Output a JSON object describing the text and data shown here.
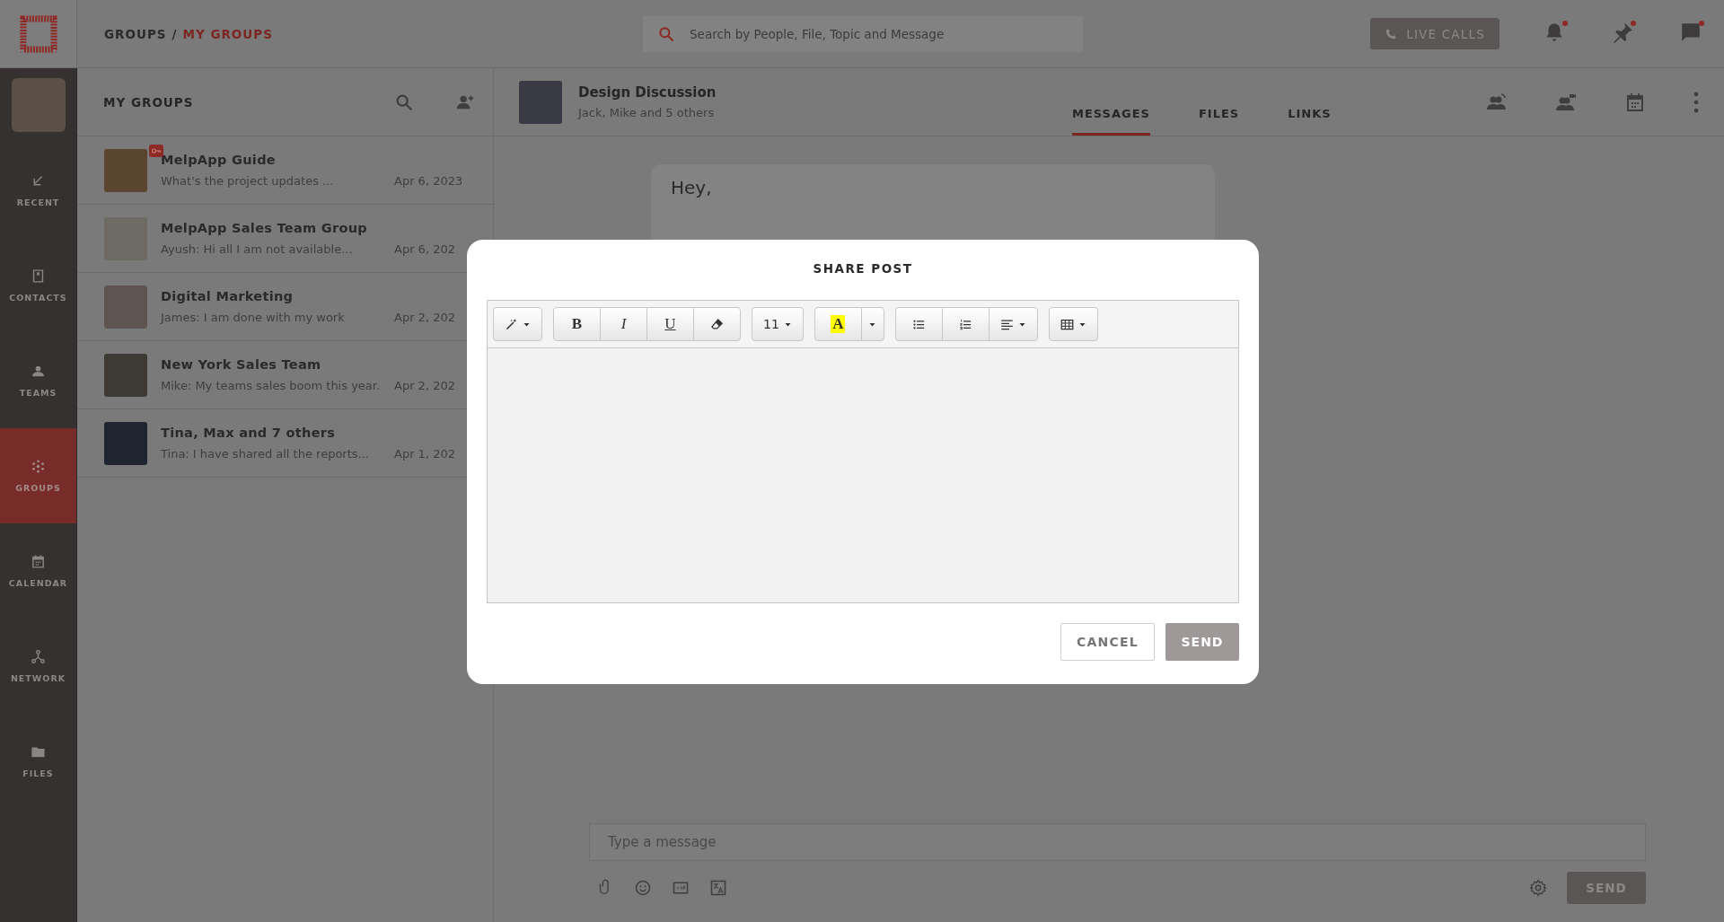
{
  "top_bar": {
    "breadcrumb": [
      {
        "label": "GROUPS",
        "current": false
      },
      {
        "label": "MY GROUPS",
        "current": true
      }
    ],
    "separator": "/",
    "search": {
      "placeholder": "Search by People, File, Topic and Message"
    },
    "live_calls": "LIVE CALLS",
    "icons": [
      {
        "kind": "bell",
        "notify": true
      },
      {
        "kind": "pin",
        "notify": true
      },
      {
        "kind": "chat",
        "notify": true
      }
    ]
  },
  "nav": {
    "items": [
      {
        "kind": "recent",
        "label": "RECENT",
        "selected": false
      },
      {
        "kind": "contacts",
        "label": "CONTACTS",
        "selected": false
      },
      {
        "kind": "teams",
        "label": "TEAMS",
        "selected": false
      },
      {
        "kind": "groups",
        "label": "GROUPS",
        "selected": true
      },
      {
        "kind": "calendar",
        "label": "CALENDAR",
        "selected": false
      },
      {
        "kind": "network",
        "label": "NETWORK",
        "selected": false
      },
      {
        "kind": "files",
        "label": "FILES",
        "selected": false
      }
    ]
  },
  "group_list": {
    "title": "MY GROUPS",
    "items": [
      {
        "name": "MelpApp Guide",
        "preview": "What's the project updates ...",
        "date": "Apr 6, 2023",
        "locked": true
      },
      {
        "name": "MelpApp Sales Team Group",
        "preview": "Ayush: Hi all I am not available...",
        "date": "Apr 6, 202",
        "locked": false
      },
      {
        "name": "Digital Marketing",
        "preview": "James: I am done with my work",
        "date": "Apr 2, 202",
        "locked": false
      },
      {
        "name": "New York Sales Team",
        "preview": "Mike: My teams sales boom this year.",
        "date": "Apr 2, 202",
        "locked": false
      },
      {
        "name": "Tina, Max and 7 others",
        "preview": "Tina: I have shared all the reports...",
        "date": "Apr 1, 202",
        "locked": false
      }
    ]
  },
  "chat": {
    "title": "Design Discussion",
    "subtitle": "Jack, Mike and 5 others",
    "tabs": [
      {
        "label": "MESSAGES",
        "selected": true
      },
      {
        "label": "FILES",
        "selected": false
      },
      {
        "label": "LINKS",
        "selected": false
      }
    ],
    "header_icons": [
      {
        "kind": "group-call"
      },
      {
        "kind": "group-video"
      },
      {
        "kind": "calendar"
      },
      {
        "kind": "more"
      }
    ],
    "message": "Hey,",
    "composer": {
      "placeholder": "Type a message",
      "tools": [
        {
          "kind": "attach"
        },
        {
          "kind": "emoji"
        },
        {
          "kind": "gif"
        },
        {
          "kind": "translate"
        }
      ],
      "send": "SEND"
    }
  },
  "modal": {
    "title": "SHARE POST",
    "toolbar": [
      [
        {
          "kind": "magic",
          "caret": true
        }
      ],
      [
        {
          "kind": "bold",
          "label": "B",
          "caret": false
        },
        {
          "kind": "italic",
          "label": "I",
          "caret": false
        },
        {
          "kind": "underline",
          "label": "U",
          "caret": false
        },
        {
          "kind": "eraser",
          "caret": false
        }
      ],
      [
        {
          "kind": "size",
          "label": "11",
          "caret": true
        }
      ],
      [
        {
          "kind": "highlight",
          "label": "A",
          "caret": false
        },
        {
          "kind": "dropdown",
          "caret": true
        }
      ],
      [
        {
          "kind": "bullets",
          "caret": false
        },
        {
          "kind": "numbers",
          "caret": false
        },
        {
          "kind": "align",
          "caret": true
        }
      ],
      [
        {
          "kind": "table",
          "caret": true
        }
      ]
    ],
    "cancel": "CANCEL",
    "send": "SEND"
  }
}
